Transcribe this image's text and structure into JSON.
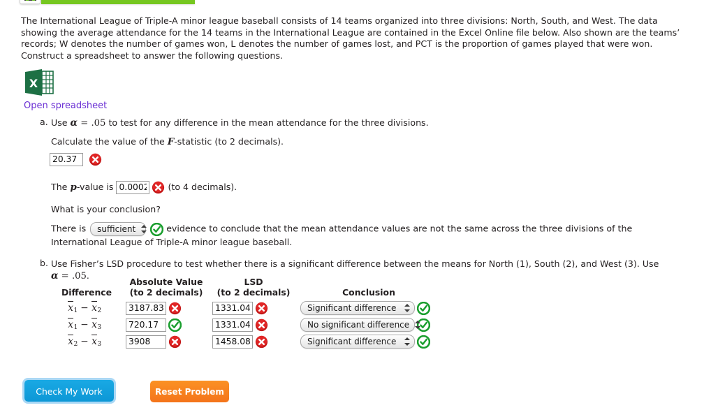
{
  "topbar": {
    "chip_icon": "progress-chip-icon",
    "bar_color": "#76c720"
  },
  "intro": {
    "text": "The International League of Triple-A minor league baseball consists of 14 teams organized into three divisions: North, South, and West. The data showing the average attendance for the 14 teams in the International League are contained in the Excel Online file below. Also shown are the teams’ records; W denotes the number of games won, L denotes the number of games lost, and PCT is the proportion of games played that were won. Construct a spreadsheet to answer the following questions."
  },
  "spreadsheet": {
    "icon": "excel-file-icon",
    "link_label": "Open spreadsheet",
    "link_color": "#6a2fd4"
  },
  "part_a": {
    "marker": "a.",
    "prompt_pre": "Use ",
    "alpha_symbol": "α",
    "equals": "=",
    "alpha_value": ".05",
    "prompt_post": " to test for any difference in the mean attendance for the three divisions.",
    "calc_pre": "Calculate the value of the ",
    "f_symbol": "F",
    "calc_post": "-statistic (to 2 decimals).",
    "f_value": "20.37",
    "f_status": "incorrect",
    "p_pre": "The ",
    "p_symbol": "p",
    "p_mid": "-value is ",
    "p_value": "0.0002",
    "p_status": "incorrect",
    "p_post": "(to 4 decimals).",
    "conclusion_question": "What is your conclusion?",
    "conclusion_pre": "There is",
    "conclusion_select_value": "sufficient",
    "conclusion_status": "correct",
    "conclusion_post": "evidence to conclude that the mean attendance values are not the same across the three divisions of the International League of Triple-A minor league baseball."
  },
  "part_b": {
    "marker": "b.",
    "prompt_pre": "Use Fisher’s LSD procedure to test whether there is a significant difference between the means for North (1), South (2), and West (3). Use ",
    "alpha_symbol": "α",
    "equals": "=",
    "alpha_value": ".05",
    "prompt_end": ".",
    "table": {
      "headers": {
        "difference": "Difference",
        "abs_line1": "Absolute Value",
        "abs_line2": "(to 2 decimals)",
        "lsd_line1": "LSD",
        "lsd_line2": "(to 2 decimals)",
        "conclusion": "Conclusion"
      },
      "rows": [
        {
          "diff_a_sub": "1",
          "diff_b_sub": "2",
          "abs_value": "3187.83",
          "abs_status": "incorrect",
          "lsd_value": "1331.04",
          "lsd_status": "incorrect",
          "conclusion_value": "Significant difference",
          "conclusion_status": "correct"
        },
        {
          "diff_a_sub": "1",
          "diff_b_sub": "3",
          "abs_value": "720.17",
          "abs_status": "correct",
          "lsd_value": "1331.04",
          "lsd_status": "incorrect",
          "conclusion_value": "No significant difference",
          "conclusion_status": "correct"
        },
        {
          "diff_a_sub": "2",
          "diff_b_sub": "3",
          "abs_value": "3908",
          "abs_status": "incorrect",
          "lsd_value": "1458.08",
          "lsd_status": "incorrect",
          "conclusion_value": "Significant difference",
          "conclusion_status": "correct"
        }
      ]
    }
  },
  "footer": {
    "check_label": "Check My Work",
    "reset_label": "Reset Problem",
    "check_color": "#0d97d6",
    "reset_color": "#f4741a"
  }
}
